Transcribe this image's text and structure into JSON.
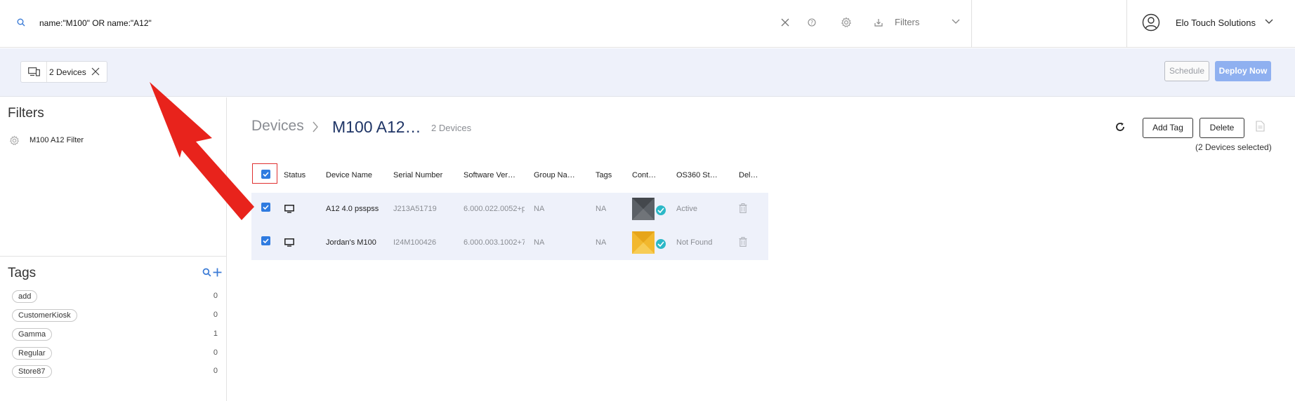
{
  "search": {
    "query": "name:\"M100\" OR name:\"A12\""
  },
  "toolbar": {
    "filters_label": "Filters"
  },
  "user": {
    "org_name": "Elo Touch Solutions"
  },
  "selection_chip": {
    "label": "2 Devices"
  },
  "actions": {
    "schedule_label": "Schedule",
    "deploy_label": "Deploy Now"
  },
  "sidebar": {
    "filters_title": "Filters",
    "filters": [
      {
        "label": "M100 A12 Filter"
      }
    ],
    "tags_title": "Tags",
    "tags": [
      {
        "name": "add",
        "count": "0"
      },
      {
        "name": "CustomerKiosk",
        "count": "0"
      },
      {
        "name": "Gamma",
        "count": "1"
      },
      {
        "name": "Regular",
        "count": "0"
      },
      {
        "name": "Store87",
        "count": "0"
      }
    ]
  },
  "main": {
    "breadcrumb_root": "Devices",
    "breadcrumb_current": "M100 A12…",
    "device_count": "2 Devices",
    "add_tag_label": "Add Tag",
    "delete_label": "Delete",
    "selected_info": "(2 Devices selected)"
  },
  "table": {
    "columns": [
      "Status",
      "Device Name",
      "Serial Number",
      "Software Ver…",
      "Group Na…",
      "Tags",
      "Cont…",
      "OS360 St…",
      "Del…"
    ],
    "rows": [
      {
        "name": "A12 4.0 psspss",
        "serial": "J213A51719",
        "software": "6.000.022.0052+p",
        "group": "NA",
        "tags": "NA",
        "os360_status": "Active",
        "selected": true,
        "thumb_color": "#5b6066"
      },
      {
        "name": "Jordan's M100",
        "serial": "I24M100426",
        "software": "6.000.003.1002+7",
        "group": "NA",
        "tags": "NA",
        "os360_status": "Not Found",
        "selected": true,
        "thumb_color": "#f2b82e"
      }
    ]
  },
  "colors": {
    "accent": "#2f7be0",
    "annotation": "#e8231c",
    "deploy_button": "#8fb0f0"
  }
}
